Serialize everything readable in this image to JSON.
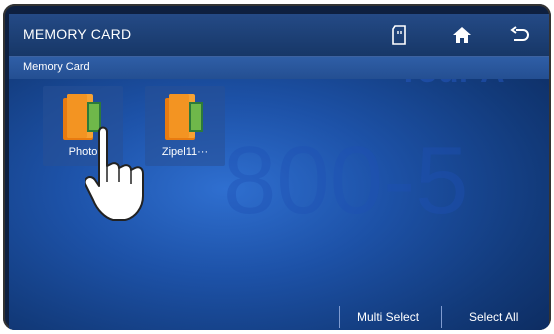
{
  "header": {
    "title": "MEMORY CARD"
  },
  "subheader": {
    "path": "Memory Card"
  },
  "toolbar": {
    "icons": [
      "sd-card-icon",
      "home-icon",
      "back-icon"
    ]
  },
  "watermark": {
    "line1": "Your A",
    "line2": "800-5"
  },
  "folders": [
    {
      "label": "Photo"
    },
    {
      "label": "Zipel11···"
    }
  ],
  "footer": {
    "multi_select": "Multi Select",
    "select_all": "Select All"
  },
  "colors": {
    "bg": "#1d52a8",
    "folder": "#f08a1a",
    "titlebar": "#244a86"
  }
}
